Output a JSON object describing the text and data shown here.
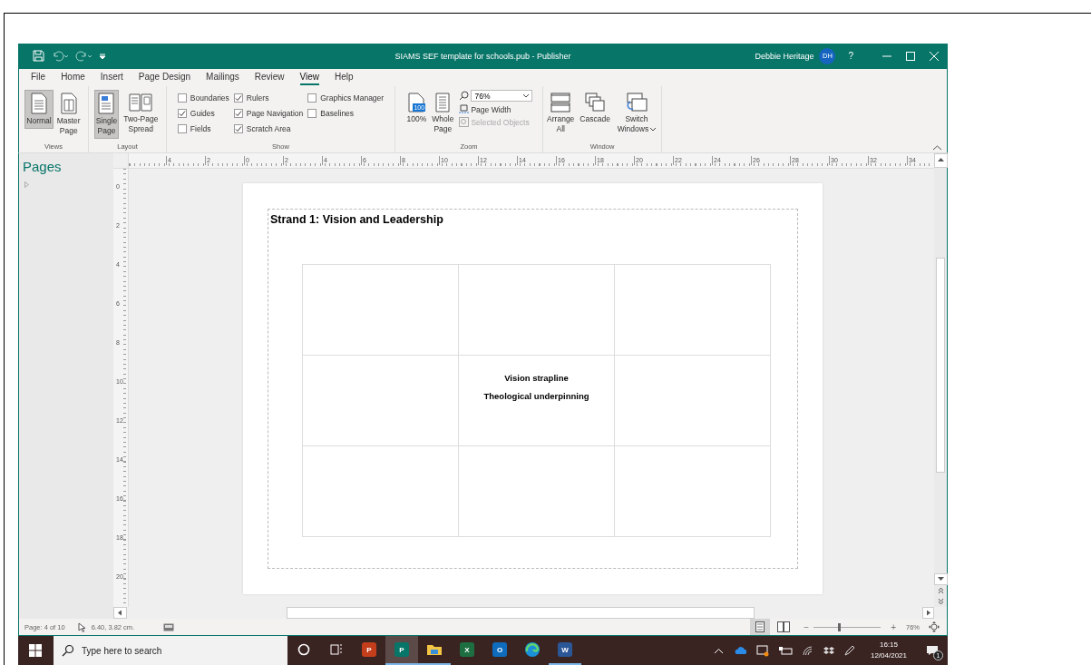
{
  "window": {
    "title": "SIAMS SEF template for schools.pub  -  Publisher",
    "user": {
      "name": "Debbie Heritage",
      "initials": "DH"
    },
    "help": "?"
  },
  "tabs": [
    {
      "label": "File",
      "selected": false
    },
    {
      "label": "Home",
      "selected": false
    },
    {
      "label": "Insert",
      "selected": false
    },
    {
      "label": "Page Design",
      "selected": false
    },
    {
      "label": "Mailings",
      "selected": false
    },
    {
      "label": "Review",
      "selected": false
    },
    {
      "label": "View",
      "selected": true
    },
    {
      "label": "Help",
      "selected": false
    }
  ],
  "ribbon": {
    "groups": [
      {
        "kind": "buttons",
        "label": "Views",
        "buttons": [
          {
            "kind": "normal",
            "label": "Normal",
            "selected": true,
            "dropdown": false
          },
          {
            "kind": "master",
            "label": "Master Page",
            "selected": false,
            "dropdown": false
          }
        ]
      },
      {
        "kind": "buttons",
        "label": "Layout",
        "buttons": [
          {
            "kind": "single",
            "label": "Single Page",
            "selected": true,
            "dropdown": false
          },
          {
            "kind": "spread",
            "label": "Two-Page Spread",
            "selected": false,
            "dropdown": false
          }
        ]
      },
      {
        "kind": "checks",
        "label": "Show",
        "columns": [
          [
            {
              "label": "Boundaries",
              "checked": false
            },
            {
              "label": "Guides",
              "checked": true
            },
            {
              "label": "Fields",
              "checked": false
            }
          ],
          [
            {
              "label": "Rulers",
              "checked": true
            },
            {
              "label": "Page Navigation",
              "checked": true
            },
            {
              "label": "Scratch Area",
              "checked": true
            }
          ],
          [
            {
              "label": "Graphics Manager",
              "checked": false
            },
            {
              "label": "Baselines",
              "checked": false
            }
          ]
        ]
      },
      {
        "kind": "zoom",
        "label": "Zoom",
        "hundred": {
          "label": "100%",
          "badge": "100"
        },
        "whole": {
          "label": "Whole Page"
        },
        "zoom_value": "76%",
        "page_width": "Page Width",
        "selected_objects": {
          "label": "Selected Objects",
          "disabled": true
        }
      },
      {
        "kind": "buttons",
        "label": "Window",
        "buttons": [
          {
            "kind": "arrange",
            "label": "Arrange All",
            "selected": false,
            "dropdown": false
          },
          {
            "kind": "cascade",
            "label": "Cascade",
            "selected": false,
            "dropdown": false
          },
          {
            "kind": "switch",
            "label": "Switch Windows",
            "selected": false,
            "dropdown": true
          }
        ]
      }
    ]
  },
  "pages_pane": {
    "title": "Pages"
  },
  "ruler": {
    "horizontal": [
      "4",
      "2",
      "0",
      "2",
      "4",
      "6",
      "8",
      "10",
      "12",
      "14",
      "16",
      "18",
      "20",
      "22",
      "24",
      "26",
      "28",
      "30",
      "32",
      "34"
    ],
    "vertical": [
      "0",
      "2",
      "4",
      "6",
      "8",
      "10",
      "12",
      "14",
      "16",
      "18",
      "20"
    ]
  },
  "document": {
    "heading": "Strand 1: Vision and Leadership",
    "table": {
      "center_cell": [
        "Vision strapline",
        "Theological underpinning"
      ]
    }
  },
  "status_bar": {
    "page": "Page: 4 of 10",
    "position": "6.40, 3.82 cm.",
    "views": [
      {
        "kind": "single",
        "selected": true
      },
      {
        "kind": "spread",
        "selected": false
      }
    ],
    "zoom": {
      "minus": "−",
      "plus": "+",
      "level": 0.38,
      "value": "76%"
    }
  },
  "taskbar": {
    "search_placeholder": "Type here to search",
    "apps": [
      {
        "kind": "cortana",
        "running": false,
        "selected": false
      },
      {
        "kind": "taskview",
        "running": false,
        "selected": false
      },
      {
        "kind": "powerpoint",
        "letter": "P",
        "running": false,
        "selected": false
      },
      {
        "kind": "publisher",
        "letter": "P",
        "running": true,
        "selected": true
      },
      {
        "kind": "explorer",
        "running": true,
        "selected": false
      },
      {
        "kind": "excel",
        "letter": "X",
        "running": false,
        "selected": false
      },
      {
        "kind": "outlook",
        "letter": "O",
        "running": false,
        "selected": false
      },
      {
        "kind": "edge",
        "running": false,
        "selected": false
      },
      {
        "kind": "word",
        "letter": "W",
        "running": true,
        "selected": false
      }
    ],
    "time": "16:15",
    "date": "12/04/2021",
    "notifications": "1"
  }
}
